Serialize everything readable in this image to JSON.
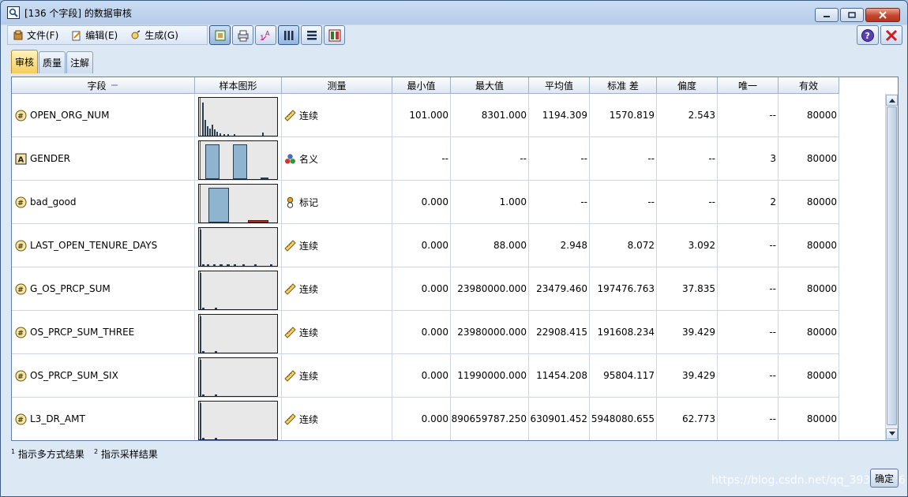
{
  "window": {
    "title": "[136 个字段] 的数据审核"
  },
  "menu": [
    {
      "label": "文件(F)",
      "icon": "file-icon"
    },
    {
      "label": "编辑(E)",
      "icon": "edit-icon"
    },
    {
      "label": "生成(G)",
      "icon": "generate-icon"
    }
  ],
  "toolbar_icons": [
    "copy-icon",
    "print-icon",
    "sort-icon",
    "columns-view-icon",
    "list-view-icon",
    "table-view-icon"
  ],
  "tabs": [
    {
      "label": "审核",
      "active": true
    },
    {
      "label": "质量",
      "active": false
    },
    {
      "label": "注解",
      "active": false
    }
  ],
  "columns": [
    "字段",
    "样本图形",
    "测量",
    "最小值",
    "最大值",
    "平均值",
    "标准 差",
    "偏度",
    "唯一",
    "有效"
  ],
  "rows": [
    {
      "field": "OPEN_ORG_NUM",
      "field_icon": "continuous-field-icon",
      "measure": "连续",
      "measure_icon": "ruler-icon",
      "min": "101.000",
      "max": "8301.000",
      "mean": "1194.309",
      "std": "1570.819",
      "skew": "2.543",
      "unique": "--",
      "valid": "80000",
      "graph": "histogram-a"
    },
    {
      "field": "GENDER",
      "field_icon": "nominal-field-icon",
      "measure": "名义",
      "measure_icon": "nominal-icon",
      "min": "--",
      "max": "--",
      "mean": "--",
      "std": "--",
      "skew": "--",
      "unique": "3",
      "valid": "80000",
      "graph": "bar-gender"
    },
    {
      "field": "bad_good",
      "field_icon": "continuous-field-icon",
      "measure": "标记",
      "measure_icon": "flag-icon",
      "min": "0.000",
      "max": "1.000",
      "mean": "--",
      "std": "--",
      "skew": "--",
      "unique": "2",
      "valid": "80000",
      "graph": "bar-flag"
    },
    {
      "field": "LAST_OPEN_TENURE_DAYS",
      "field_icon": "continuous-field-icon",
      "measure": "连续",
      "measure_icon": "ruler-icon",
      "min": "0.000",
      "max": "88.000",
      "mean": "2.948",
      "std": "8.072",
      "skew": "3.092",
      "unique": "--",
      "valid": "80000",
      "graph": "histogram-b"
    },
    {
      "field": "G_OS_PRCP_SUM",
      "field_icon": "continuous-field-icon",
      "measure": "连续",
      "measure_icon": "ruler-icon",
      "min": "0.000",
      "max": "23980000.000",
      "mean": "23479.460",
      "std": "197476.763",
      "skew": "37.835",
      "unique": "--",
      "valid": "80000",
      "graph": "histogram-c"
    },
    {
      "field": "OS_PRCP_SUM_THREE",
      "field_icon": "continuous-field-icon",
      "measure": "连续",
      "measure_icon": "ruler-icon",
      "min": "0.000",
      "max": "23980000.000",
      "mean": "22908.415",
      "std": "191608.234",
      "skew": "39.429",
      "unique": "--",
      "valid": "80000",
      "graph": "histogram-c"
    },
    {
      "field": "OS_PRCP_SUM_SIX",
      "field_icon": "continuous-field-icon",
      "measure": "连续",
      "measure_icon": "ruler-icon",
      "min": "0.000",
      "max": "11990000.000",
      "mean": "11454.208",
      "std": "95804.117",
      "skew": "39.429",
      "unique": "--",
      "valid": "80000",
      "graph": "histogram-c"
    },
    {
      "field": "L3_DR_AMT",
      "field_icon": "continuous-field-icon",
      "measure": "连续",
      "measure_icon": "ruler-icon",
      "min": "0.000",
      "max": "890659787.250",
      "mean": "630901.452",
      "std": "5948080.655",
      "skew": "62.773",
      "unique": "--",
      "valid": "80000",
      "graph": "histogram-c"
    }
  ],
  "footnotes": [
    {
      "mark": "1",
      "text": "指示多方式结果"
    },
    {
      "mark": "2",
      "text": "指示采样结果"
    }
  ],
  "ok_label": "确定",
  "watermark": "https://blog.csdn.net/qq_39304996"
}
